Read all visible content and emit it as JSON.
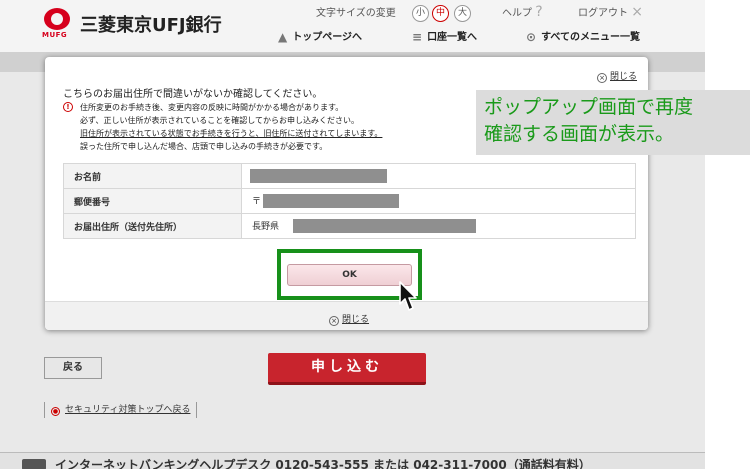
{
  "header": {
    "logo_text": "MUFG",
    "bank_name": "三菱東京UFJ銀行",
    "font_size_label": "文字サイズの変更",
    "font_size_options": [
      "小",
      "中",
      "大"
    ],
    "help_label": "ヘルプ",
    "help_icon": "?",
    "logout_label": "ログアウト",
    "logout_icon": "×",
    "nav": {
      "top_page": "トップページへ",
      "accounts": "口座一覧へ",
      "all_menu": "すべてのメニュー一覧"
    }
  },
  "modal": {
    "close_label": "閉じる",
    "close_icon": "×",
    "heading": "こちらのお届出住所で間違いがないか確認してください。",
    "warn_icon": "!",
    "notice_lines": [
      "住所変更のお手続き後、変更内容の反映に時間がかかる場合があります。",
      "必ず、正しい住所が表示されていることを確認してからお申し込みください。",
      "旧住所が表示されている状態でお手続きを行うと、旧住所に送付されてしまいます。",
      "誤った住所で申し込んだ場合、店頭で申し込みの手続きが必要です。"
    ],
    "rows": [
      {
        "label": "お名前",
        "prefix": ""
      },
      {
        "label": "郵便番号",
        "prefix": "〒"
      },
      {
        "label": "お届出住所（送付先住所）",
        "prefix": "長野県"
      }
    ],
    "ok_label": "OK",
    "close_bottom_label": "閉じる"
  },
  "page": {
    "back_label": "戻る",
    "apply_label": "申し込む",
    "security_link": "セキュリティ対策トップへ戻る",
    "security_icon": "●",
    "footer_text": "インターネットバンキングヘルプデスク 0120-543-555 または 042-311-7000（通話料有料）"
  },
  "annotation": {
    "line1": "ポップアップ画面で再度",
    "line2": "確認する画面が表示。",
    "highlight_color": "#17901a",
    "text_color": "#1a9a1a"
  },
  "colors": {
    "brand_red": "#d6001c",
    "apply_button": "#c8242d",
    "ok_button": "#f4dade"
  }
}
